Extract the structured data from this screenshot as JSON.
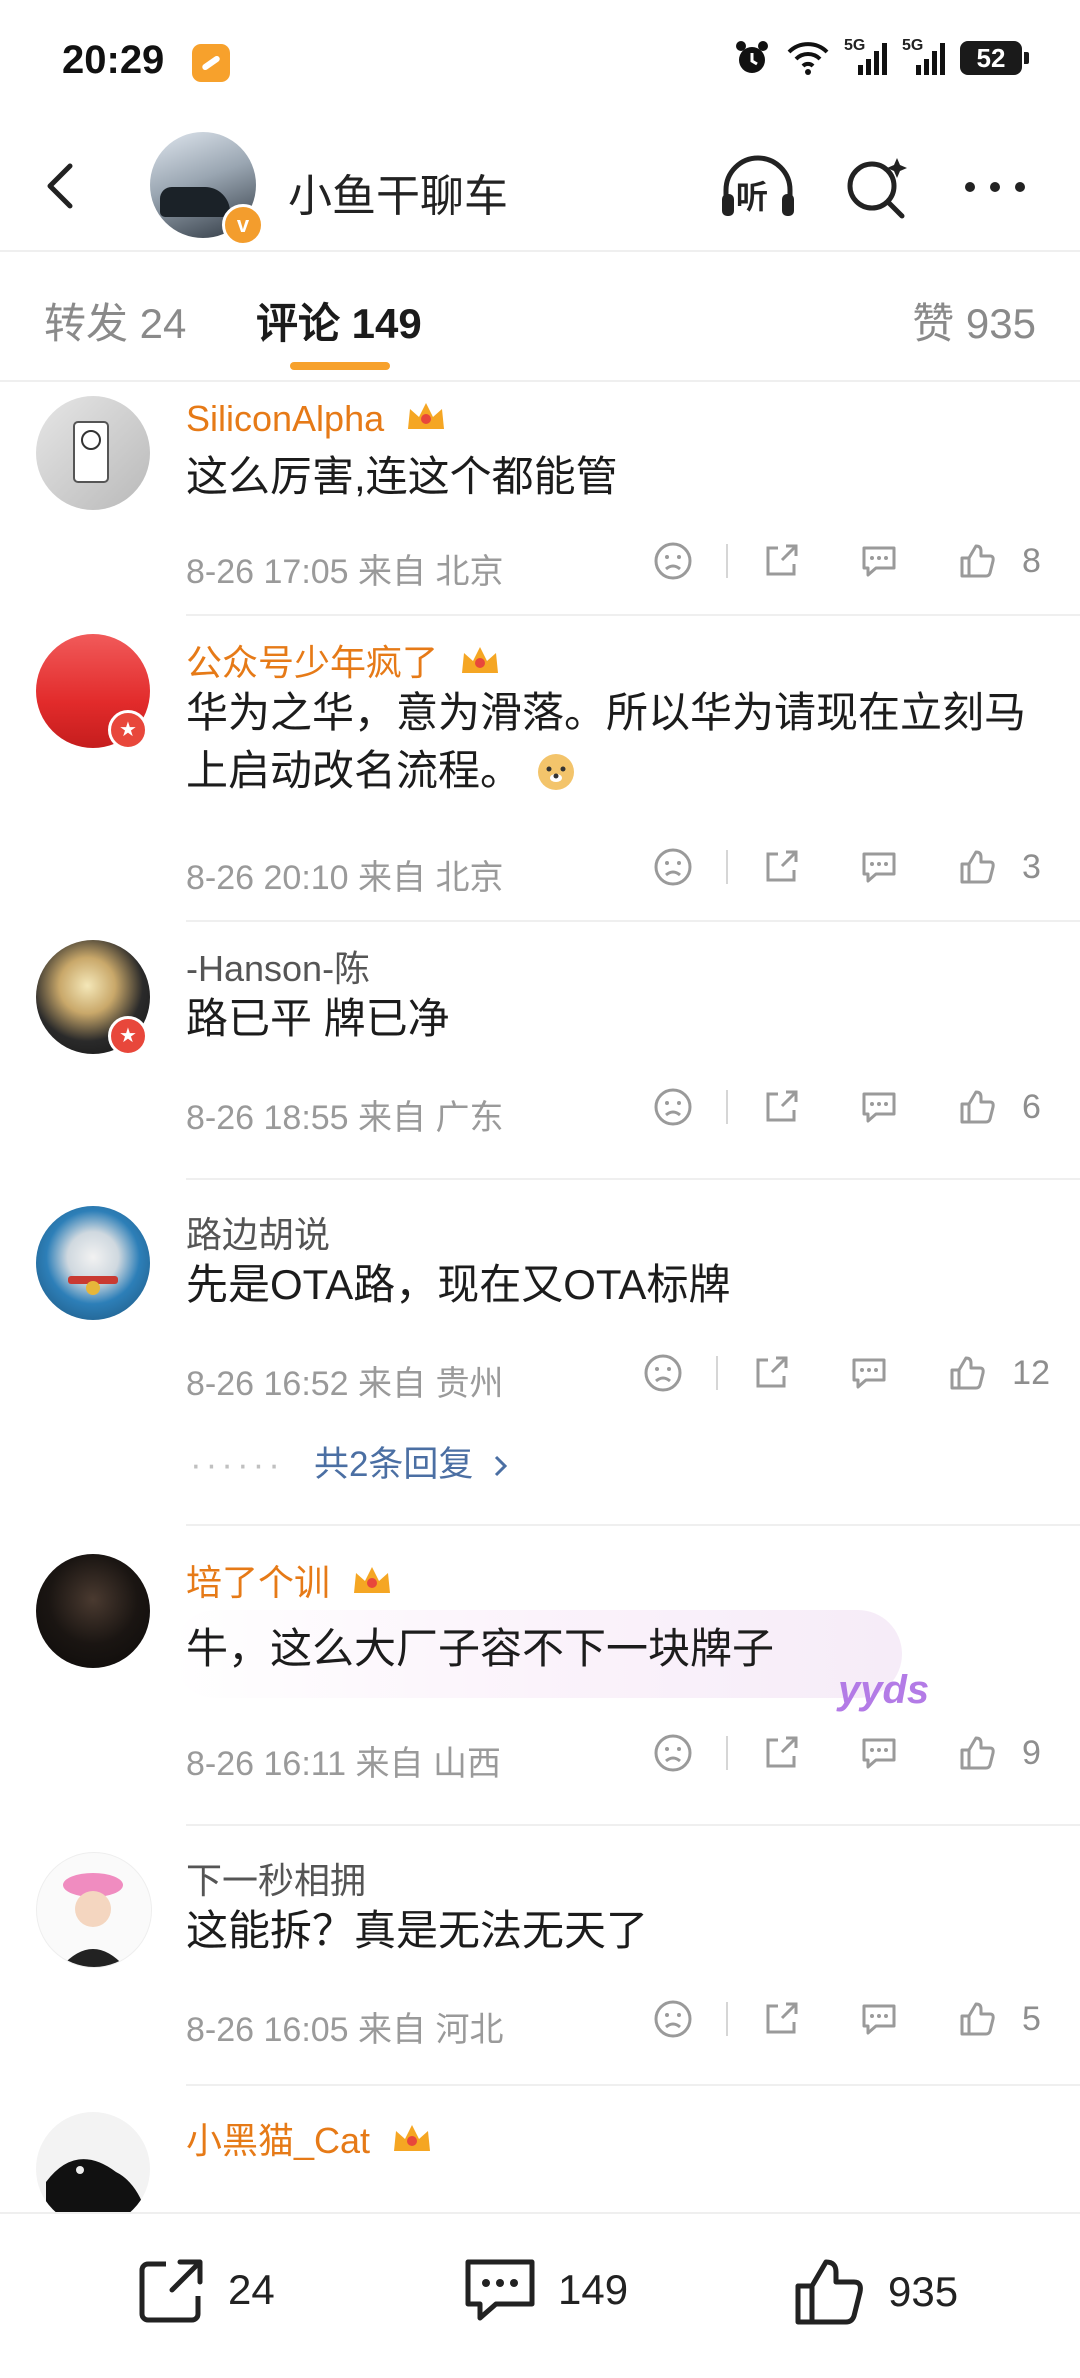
{
  "status_bar": {
    "time": "20:29",
    "network_1": "5G",
    "network_2": "5G",
    "battery": "52"
  },
  "header": {
    "account_name": "小鱼干聊车",
    "listen_label": "听",
    "verified_mark": "v"
  },
  "tabs": {
    "repost": "转发 24",
    "comments": "评论 149",
    "likes": "赞 935"
  },
  "comments": [
    {
      "user": "SiliconAlpha",
      "vip": true,
      "text": "这么厉害,连这个都能管",
      "date": "8-26 17:05",
      "location": "来自 北京",
      "likes": "8"
    },
    {
      "user": "公众号少年疯了",
      "vip": true,
      "text": "华为之华，意为滑落。所以华为请现在立刻马上启动改名流程。",
      "date": "8-26 20:10",
      "location": "来自 北京",
      "likes": "3"
    },
    {
      "user": "-Hanson-陈",
      "vip": false,
      "text": "路已平 牌已净",
      "date": "8-26 18:55",
      "location": "来自 广东",
      "likes": "6"
    },
    {
      "user": "路边胡说",
      "vip": false,
      "text": "先是OTA路，现在又OTA标牌",
      "date": "8-26 16:52",
      "location": "来自 贵州",
      "likes": "12",
      "replies": "共2条回复"
    },
    {
      "user": "培了个训",
      "vip": true,
      "text": "牛，这么大厂子容不下一块牌子",
      "date": "8-26 16:11",
      "location": "来自 山西",
      "likes": "9",
      "bubble_tag": "yyds"
    },
    {
      "user": "下一秒相拥",
      "vip": false,
      "text": "这能拆？真是无法无天了",
      "date": "8-26 16:05",
      "location": "来自 河北",
      "likes": "5"
    },
    {
      "user": "小黑猫_Cat",
      "vip": true
    }
  ],
  "bottom_bar": {
    "repost_count": "24",
    "comment_count": "149",
    "like_count": "935"
  },
  "colors": {
    "accent": "#f7a12c",
    "vip_name": "#e67a17",
    "link": "#4b6fa3"
  }
}
